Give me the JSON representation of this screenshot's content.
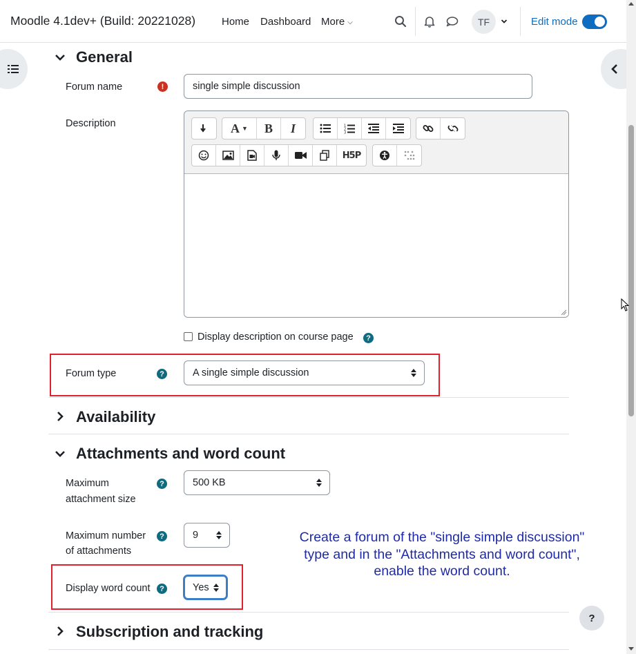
{
  "navbar": {
    "site_name": "Moodle 4.1dev+ (Build: 20221028)",
    "links": [
      "Home",
      "Dashboard",
      "More"
    ],
    "avatar_initials": "TF",
    "edit_mode_label": "Edit mode",
    "edit_mode_on": true
  },
  "sections": {
    "general": "General",
    "availability": "Availability",
    "attachments": "Attachments and word count",
    "subscription": "Subscription and tracking"
  },
  "general": {
    "forum_name_label": "Forum name",
    "forum_name_value": "single simple discussion",
    "description_label": "Description",
    "display_description_label": "Display description on course page",
    "display_description_checked": false,
    "forum_type_label": "Forum type",
    "forum_type_value": "A single simple discussion"
  },
  "attachments": {
    "max_size_label_line1": "Maximum",
    "max_size_label_line2": "attachment size",
    "max_size_value": "500 KB",
    "max_number_label_line1": "Maximum number",
    "max_number_label_line2": "of attachments",
    "max_number_value": "9",
    "word_count_label": "Display word count",
    "word_count_value": "Yes"
  },
  "instruction": {
    "line1": "Create a forum of the \"single simple discussion\"",
    "line2": "type and in the \"Attachments and word count\",",
    "line3": "enable the word count."
  },
  "help_button_label": "?",
  "colors": {
    "brand_blue": "#0f6cbf",
    "help_teal": "#0f6b7f",
    "required_red": "#ca3120",
    "annotation_red": "#e0202a",
    "instruction_blue": "#1f2aa8"
  },
  "editor_toolbar": {
    "row1": [
      "insert-paragraph-icon",
      "font-style-icon",
      "bold-icon",
      "italic-icon",
      "unordered-list-icon",
      "ordered-list-icon",
      "outdent-icon",
      "indent-icon",
      "link-icon",
      "unlink-icon"
    ],
    "row2": [
      "emoji-icon",
      "image-icon",
      "media-icon",
      "record-audio-icon",
      "record-video-icon",
      "manage-files-icon",
      "h5p-icon",
      "accessibility-checker-icon",
      "screenreader-helper-icon"
    ]
  }
}
